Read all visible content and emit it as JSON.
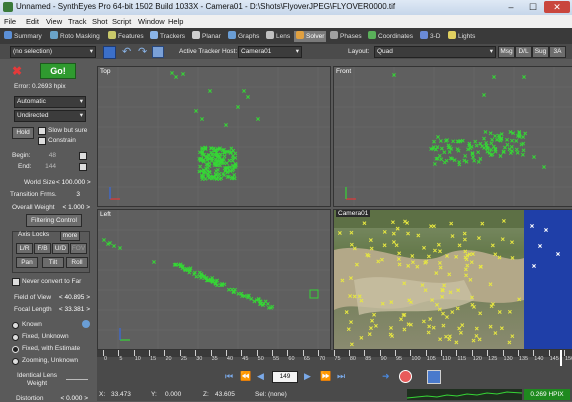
{
  "window": {
    "title": "Unnamed - SynthEyes Pro 64-bit 1502 Build 1033X - Camera01 - D:\\Shots\\FlyoverJPEG\\FLYOVER0000.tif",
    "minimize": "–",
    "maximize": "☐",
    "close": "✕"
  },
  "menu": [
    "File",
    "Edit",
    "View",
    "Track",
    "Shot",
    "Script",
    "Window",
    "Help"
  ],
  "rooms": [
    {
      "label": "Summary",
      "color": "#5b8fd6"
    },
    {
      "label": "Roto Masking",
      "color": "#6aa3c8"
    },
    {
      "label": "Features",
      "color": "#c8c86a"
    },
    {
      "label": "Trackers",
      "color": "#8ab4e8"
    },
    {
      "label": "Planar",
      "color": "#d0d0d0"
    },
    {
      "label": "Graphs",
      "color": "#6a9ed6"
    },
    {
      "label": "Lens",
      "color": "#c0c0c0"
    },
    {
      "label": "Solver",
      "color": "#e0a040"
    },
    {
      "label": "Phases",
      "color": "#a0a0a0"
    },
    {
      "label": "Coordinates",
      "color": "#5ab05a"
    },
    {
      "label": "3-D",
      "color": "#6a8ad6"
    },
    {
      "label": "Lights",
      "color": "#e0d060"
    }
  ],
  "toolbar": {
    "selection": "(no selection)",
    "active_tracker_host_label": "Active Tracker Host:",
    "active_tracker_host": "Camera01",
    "layout_label": "Layout:",
    "layout": "Quad",
    "right_buttons": [
      "Msg",
      "D/L",
      "Sug",
      "3A"
    ]
  },
  "solver": {
    "go": "Go!",
    "error": "Error: 0.2693 hpix",
    "mode": "Automatic",
    "direction": "Undirected",
    "hold": "Hold",
    "slow_but_sure": "Slow but sure",
    "constrain": "Constrain",
    "begin_label": "Begin:",
    "begin": "48",
    "end_label": "End:",
    "end": "144",
    "world_size_label": "World Size",
    "world_size": "< 100.000 >",
    "transition_frms_label": "Transition Frms.",
    "transition_frms": "3",
    "overall_weight_label": "Overall Weight",
    "overall_weight": "< 1.000 >",
    "filtering_control": "Filtering Control",
    "axis_locks": "Axis Locks",
    "more": "more",
    "locks_row1": [
      "L/R",
      "F/B",
      "U/D",
      "FOV"
    ],
    "locks_row2": [
      "Pan",
      "Tilt",
      "Roll"
    ],
    "never_convert_to_far": "Never convert to Far",
    "field_of_view_label": "Field of View",
    "field_of_view": "< 40.895 >",
    "focal_length_label": "Focal Length",
    "focal_length": "< 33.381 >",
    "lens_modes": [
      "Known",
      "Fixed, Unknown",
      "Fixed, with Estimate",
      "Zooming, Unknown"
    ],
    "identical_lens_weight": "Identical Lens Weight",
    "distortion_label": "Distortion",
    "distortion": "< 0.000 >"
  },
  "viewports": {
    "top": "Top",
    "front": "Front",
    "left": "Left",
    "camera": "Camera01"
  },
  "timeline": {
    "ticks": [
      "0",
      "5",
      "10",
      "15",
      "20",
      "25",
      "30",
      "35",
      "40",
      "45",
      "50",
      "55",
      "60",
      "65",
      "70",
      "75",
      "80",
      "85",
      "90",
      "95",
      "100",
      "105",
      "110",
      "115",
      "120",
      "125",
      "130",
      "135",
      "140",
      "145",
      "150"
    ]
  },
  "playback": {
    "frame": "149"
  },
  "status": {
    "x_label": "X:",
    "x": "33.473",
    "y_label": "Y:",
    "y": "0.000",
    "z_label": "Z:",
    "z": "43.605",
    "sel": "Sel: (none)",
    "hpix": "0.269 HPIX"
  },
  "colors": {
    "tracker": "#36d636",
    "camera_tracker": "#e8e840",
    "go_button": "#2f9a2f",
    "blue_overlay": "#1f3fa8"
  }
}
